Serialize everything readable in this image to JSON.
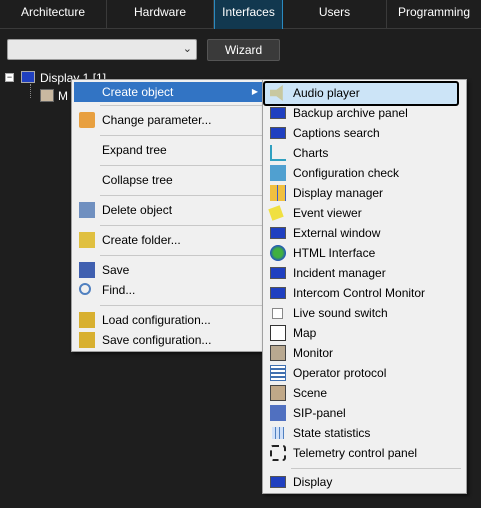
{
  "tabs": [
    {
      "label": "Architecture"
    },
    {
      "label": "Hardware"
    },
    {
      "label": "Interfaces"
    },
    {
      "label": "Users"
    },
    {
      "label": "Programming"
    }
  ],
  "toolbar": {
    "combo_value": "",
    "wizard_label": "Wizard"
  },
  "tree": {
    "expander": "−",
    "root_label": "Display 1 [1]",
    "child_label": "M"
  },
  "context_menu": {
    "items": [
      {
        "label": "Create object",
        "icon": "none",
        "submenu": true
      },
      {
        "label": "Change parameter...",
        "icon": "wrench-icon"
      },
      {
        "label": "Expand tree",
        "icon": "none"
      },
      {
        "label": "Collapse tree",
        "icon": "none"
      },
      {
        "label": "Delete object",
        "icon": "delete-icon"
      },
      {
        "label": "Create folder...",
        "icon": "folder-new-icon"
      },
      {
        "label": "Save",
        "icon": "save-icon"
      },
      {
        "label": "Find...",
        "icon": "magnifier-icon"
      },
      {
        "label": "Load configuration...",
        "icon": "folder-icon"
      },
      {
        "label": "Save configuration...",
        "icon": "folder-save-icon"
      }
    ],
    "submenu_arrow": "▶"
  },
  "submenu": {
    "items": [
      {
        "label": "Audio player",
        "icon": "speaker-icon"
      },
      {
        "label": "Backup archive panel",
        "icon": "monitor-icon"
      },
      {
        "label": "Captions search",
        "icon": "monitor-icon"
      },
      {
        "label": "Charts",
        "icon": "chart-icon"
      },
      {
        "label": "Configuration check",
        "icon": "check-icon"
      },
      {
        "label": "Display manager",
        "icon": "grid-icon"
      },
      {
        "label": "Event viewer",
        "icon": "note-icon"
      },
      {
        "label": "External window",
        "icon": "monitor-icon"
      },
      {
        "label": "HTML Interface",
        "icon": "globe-icon"
      },
      {
        "label": "Incident manager",
        "icon": "monitor-icon"
      },
      {
        "label": "Intercom Control Monitor",
        "icon": "monitor-icon"
      },
      {
        "label": "Live sound switch",
        "icon": "switch-icon"
      },
      {
        "label": "Map",
        "icon": "map-icon"
      },
      {
        "label": "Monitor",
        "icon": "camera-icon"
      },
      {
        "label": "Operator protocol",
        "icon": "list-icon"
      },
      {
        "label": "Scene",
        "icon": "person-icon"
      },
      {
        "label": "SIP-panel",
        "icon": "sip-icon"
      },
      {
        "label": "State statistics",
        "icon": "table-icon"
      },
      {
        "label": "Telemetry control panel",
        "icon": "target-icon"
      },
      {
        "label": "Display",
        "icon": "monitor-icon"
      }
    ]
  },
  "colors": {
    "highlight": "#3274c4",
    "tab_active": "#12384f",
    "menu_bg": "#f0f0f0"
  }
}
